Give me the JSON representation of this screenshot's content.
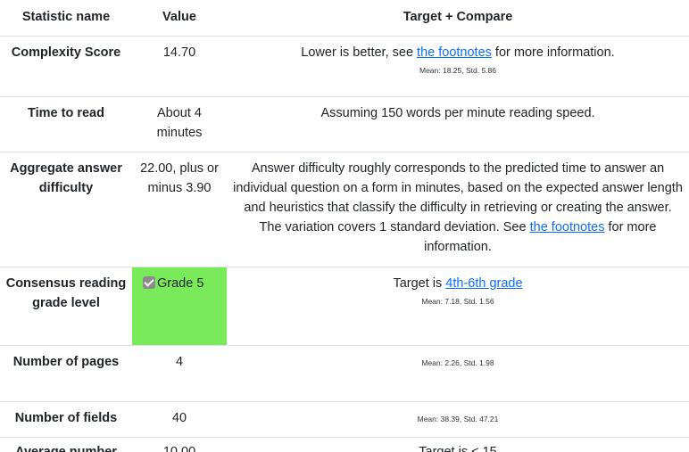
{
  "table": {
    "headers": {
      "name": "Statistic name",
      "value": "Value",
      "target": "Target + Compare"
    },
    "rows": {
      "complexity": {
        "name": "Complexity Score",
        "value": "14.70",
        "target_before": "Lower is better, see ",
        "target_link": "the footnotes",
        "target_after": " for more information.",
        "stats": "Mean: 18.25, Std. 5.86"
      },
      "time": {
        "name": "Time to read",
        "value": "About 4 minutes",
        "target": "Assuming 150 words per minute reading speed."
      },
      "difficulty": {
        "name": "Aggregate answer difficulty",
        "value": "22.00, plus or minus 3.90",
        "target_before": "Answer difficulty roughly corresponds to the predicted time to answer an individual question on a form in minutes, based on the expected answer length and heuristics that classify the difficulty in retrieving or creating the answer. The variation covers 1 standard deviation. See ",
        "target_link": "the footnotes",
        "target_after": " for more information."
      },
      "grade": {
        "name": "Consensus reading grade level",
        "value": "Grade 5",
        "checked": true,
        "highlight_color": "#79ea5a",
        "target_before": "Target is ",
        "target_link": "4th-6th grade",
        "stats": "Mean: 7.18, Std. 1.56"
      },
      "pages": {
        "name": "Number of pages",
        "value": "4",
        "stats": "Mean: 2.26, Std. 1.98"
      },
      "fields": {
        "name": "Number of fields",
        "value": "40",
        "stats": "Mean: 38.39, Std. 47.21"
      },
      "average": {
        "name": "Average number",
        "value": "10.00",
        "target": "Target is < 15"
      }
    }
  },
  "colors": {
    "link": "#0d6efd",
    "text": "#212529",
    "border": "#dee2e6",
    "checkbox": "#8a8a8a"
  }
}
